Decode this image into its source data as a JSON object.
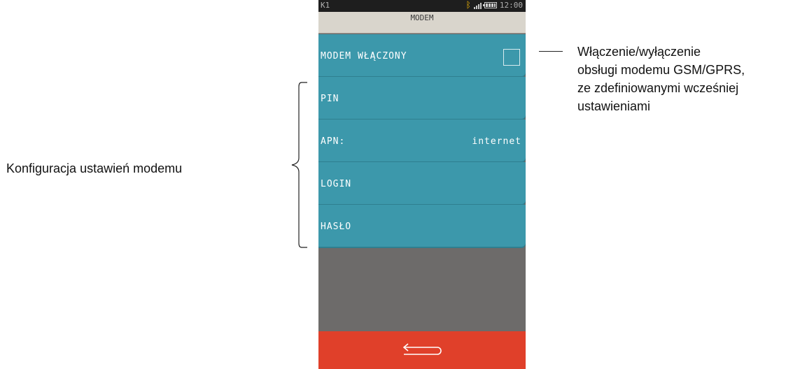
{
  "statusbar": {
    "slot": "K1",
    "time": "12:00",
    "icons": [
      "bluetooth-icon",
      "signal-icon",
      "battery-icon"
    ]
  },
  "screen": {
    "title": "MODEM"
  },
  "menu": {
    "items": [
      {
        "label": "MODEM WŁĄCZONY",
        "control": "checkbox",
        "checked": false
      },
      {
        "label": "PIN",
        "value": ""
      },
      {
        "label": "APN:",
        "value": "internet"
      },
      {
        "label": "LOGIN",
        "value": ""
      },
      {
        "label": "HASŁO",
        "value": ""
      }
    ]
  },
  "bottombar": {
    "icon": "back-arrow-icon"
  },
  "annotations": {
    "right_lines": [
      "Włączenie/wyłączenie",
      "obsługi modemu GSM/GPRS,",
      "ze zdefiniowanymi wcześniej",
      "ustawieniami"
    ],
    "left": "Konfiguracja ustawień modemu"
  },
  "colors": {
    "menu_item": "#3c98ab",
    "title_bar": "#d9d5cc",
    "status_bar": "#1e1e1e",
    "background": "#6d6b6a",
    "bottom_bar": "#e0402a",
    "bluetooth": "#f2b705"
  }
}
